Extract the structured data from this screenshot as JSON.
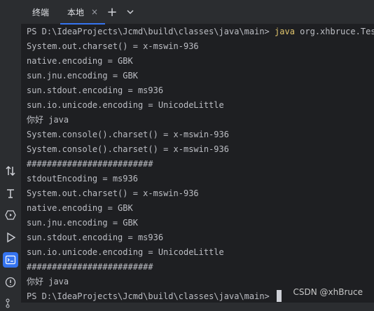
{
  "tabs": [
    {
      "label": "终端",
      "active": false
    },
    {
      "label": "本地",
      "active": true
    }
  ],
  "tab_close_glyph": "×",
  "add_tab_glyph": "+",
  "dropdown_glyph": "⌄",
  "terminal": {
    "prompt_line": {
      "prompt": "PS D:\\IdeaProjects\\Jcmd\\build\\classes\\java\\main> ",
      "command": "java",
      "args": " org.xhbruce.Test"
    },
    "lines": [
      "System.out.charset() = x-mswin-936",
      "native.encoding = GBK",
      "sun.jnu.encoding = GBK",
      "sun.stdout.encoding = ms936",
      "sun.io.unicode.encoding = UnicodeLittle",
      "你好 java",
      "System.console().charset() = x-mswin-936",
      "System.console().charset() = x-mswin-936",
      "#########################",
      "stdoutEncoding = ms936",
      "System.out.charset() = x-mswin-936",
      "native.encoding = GBK",
      "sun.jnu.encoding = GBK",
      "sun.stdout.encoding = ms936",
      "sun.io.unicode.encoding = UnicodeLittle",
      "#########################",
      "你好 java"
    ],
    "final_prompt": "PS D:\\IdeaProjects\\Jcmd\\build\\classes\\java\\main> "
  },
  "watermark": "CSDN @xhBruce",
  "icons": [
    "sort-icon",
    "text-format-icon",
    "services-icon",
    "run-icon",
    "terminal-icon",
    "problems-icon",
    "git-icon"
  ],
  "colors": {
    "accent": "#3574f0",
    "command": "#e0c46c",
    "text": "#bcbec4",
    "bg": "#1e1f22"
  }
}
